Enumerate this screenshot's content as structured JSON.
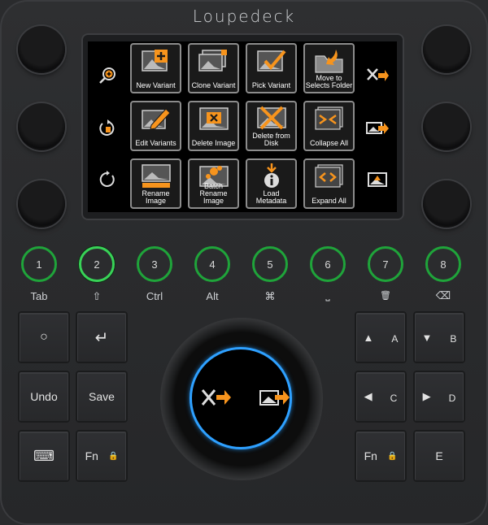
{
  "brand": "Loupedeck",
  "screen": {
    "left_actions": [
      "zoom-in",
      "rotate-ccw",
      "rotate-cw"
    ],
    "right_actions": [
      "tools-next",
      "image-next",
      "image-up"
    ],
    "tiles": [
      {
        "label": "New Variant",
        "icon": "new-variant-icon"
      },
      {
        "label": "Clone Variant",
        "icon": "clone-variant-icon"
      },
      {
        "label": "Pick Variant",
        "icon": "pick-variant-icon"
      },
      {
        "label": "Move to Selects Folder",
        "icon": "move-folder-icon"
      },
      {
        "label": "Edit Variants",
        "icon": "edit-variants-icon"
      },
      {
        "label": "Delete Image",
        "icon": "delete-image-icon"
      },
      {
        "label": "Delete from Disk",
        "icon": "delete-disk-icon"
      },
      {
        "label": "Collapse All",
        "icon": "collapse-all-icon"
      },
      {
        "label": "Rename Image",
        "icon": "rename-image-icon"
      },
      {
        "label": "Batch Rename Image",
        "icon": "batch-rename-icon"
      },
      {
        "label": "Load Metadata",
        "icon": "load-metadata-icon"
      },
      {
        "label": "Expand All",
        "icon": "expand-all-icon"
      }
    ]
  },
  "round_buttons": [
    {
      "number": "1",
      "label": "Tab",
      "active": false
    },
    {
      "number": "2",
      "label": "⇧",
      "active": true
    },
    {
      "number": "3",
      "label": "Ctrl",
      "active": false
    },
    {
      "number": "4",
      "label": "Alt",
      "active": false
    },
    {
      "number": "5",
      "label": "⌘",
      "active": false
    },
    {
      "number": "6",
      "label": "⎵",
      "active": false
    },
    {
      "number": "7",
      "label": "🗑",
      "active": false
    },
    {
      "number": "8",
      "label": "⌫",
      "active": false
    }
  ],
  "left_keys": {
    "circle": "○",
    "enter": "↵",
    "undo": "Undo",
    "save": "Save",
    "keyboard": "⌨",
    "fn": "Fn",
    "lock": "🔒"
  },
  "right_keys": {
    "up": "▲",
    "a": "A",
    "down": "▼",
    "b": "B",
    "left": "◀",
    "c": "C",
    "right": "▶",
    "d": "D",
    "fn": "Fn",
    "lock": "🔒",
    "e": "E"
  },
  "accent": "#f7941d",
  "ring_color": "#2ea0ff",
  "led_color": "#1fa43a"
}
